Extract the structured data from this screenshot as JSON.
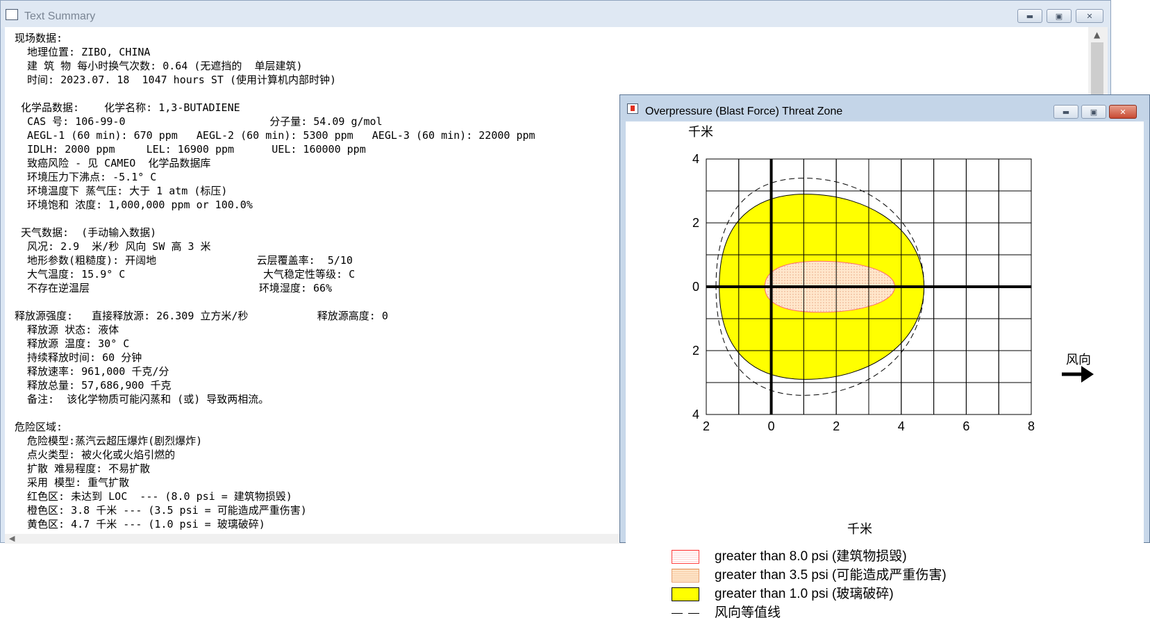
{
  "text_summary": {
    "title": "Text Summary",
    "lines": [
      "现场数据:",
      "  地理位置: ZIBO, CHINA",
      "  建 筑 物 每小时换气次数: 0.64 (无遮挡的  单层建筑)",
      "  时间: 2023.07. 18  1047 hours ST (使用计算机内部时钟)",
      "",
      " 化学品数据:    化学名称: 1,3-BUTADIENE",
      "  CAS 号: 106-99-0                       分子量: 54.09 g/mol",
      "  AEGL-1 (60 min): 670 ppm   AEGL-2 (60 min): 5300 ppm   AEGL-3 (60 min): 22000 ppm",
      "  IDLH: 2000 ppm     LEL: 16900 ppm      UEL: 160000 ppm",
      "  致癌风险 - 见 CAMEO  化学品数据库",
      "  环境压力下沸点: -5.1° C",
      "  环境温度下 蒸气压: 大于 1 atm (标压)",
      "  环境饱和 浓度: 1,000,000 ppm or 100.0%",
      "",
      " 天气数据:  (手动输入数据)",
      "  风况: 2.9  米/秒 风向 SW 高 3 米",
      "  地形参数(粗糙度): 开阔地                云层覆盖率:  5/10",
      "  大气温度: 15.9° C                      大气稳定性等级: C",
      "  不存在逆温层                           环境湿度: 66%",
      "",
      "释放源强度:   直接释放源: 26.309 立方米/秒           释放源高度: 0",
      "  释放源 状态: 液体",
      "  释放源 温度: 30° C",
      "  持续释放时间: 60 分钟",
      "  释放速率: 961,000 千克/分",
      "  释放总量: 57,686,900 千克",
      "  备注:  该化学物质可能闪蒸和 (或) 导致两相流。",
      "",
      "危险区域:",
      "  危险模型:蒸汽云超压爆炸(剧烈爆炸)",
      "  点火类型: 被火化或火焰引燃的",
      "  扩散 难易程度: 不易扩散",
      "  采用 模型: 重气扩散",
      "  红色区: 未达到 LOC  --- (8.0 psi = 建筑物损毁)",
      "  橙色区: 3.8 千米 --- (3.5 psi = 可能造成严重伤害)",
      "  黄色区: 4.7 千米 --- (1.0 psi = 玻璃破碎)"
    ]
  },
  "threat_zone": {
    "title": "Overpressure (Blast Force) Threat Zone",
    "y_unit": "千米",
    "x_unit": "千米",
    "y_ticks": [
      "4",
      "2",
      "0",
      "2",
      "4"
    ],
    "x_ticks": [
      "2",
      "0",
      "2",
      "4",
      "6",
      "8"
    ],
    "wind_label": "风向",
    "legend": [
      {
        "label": "greater than 8.0 psi (建筑物损毁)",
        "color": "#ff3333"
      },
      {
        "label": "greater than 3.5 psi (可能造成严重伤害)",
        "color": "#ffcc99"
      },
      {
        "label": "greater than 1.0 psi (玻璃破碎)",
        "color": "#ffff00"
      },
      {
        "label": "风向等值线",
        "color": "#000000"
      }
    ]
  },
  "chart_data": {
    "type": "threat-zone",
    "title": "Overpressure (Blast Force) Threat Zone",
    "xlabel": "千米",
    "ylabel": "千米",
    "xlim": [
      -2,
      8
    ],
    "ylim": [
      -4,
      4
    ],
    "x_tick_values": [
      -2,
      0,
      2,
      4,
      6,
      8
    ],
    "y_tick_values": [
      4,
      2,
      0,
      -2,
      -4
    ],
    "grid": true,
    "zones": [
      {
        "name": "greater than 3.5 psi (可能造成严重伤害)",
        "color": "#ffcc99",
        "x_range": [
          -0.2,
          3.8
        ],
        "half_width_max": 0.8
      },
      {
        "name": "greater than 1.0 psi (玻璃破碎)",
        "color": "#ffff00",
        "x_range": [
          -1.6,
          4.7
        ],
        "half_width_max": 2.9
      },
      {
        "name": "风向等值线",
        "color": "#000000",
        "style": "dashed",
        "x_range": [
          -1.7,
          4.7
        ],
        "half_width_max": 3.4
      }
    ]
  }
}
